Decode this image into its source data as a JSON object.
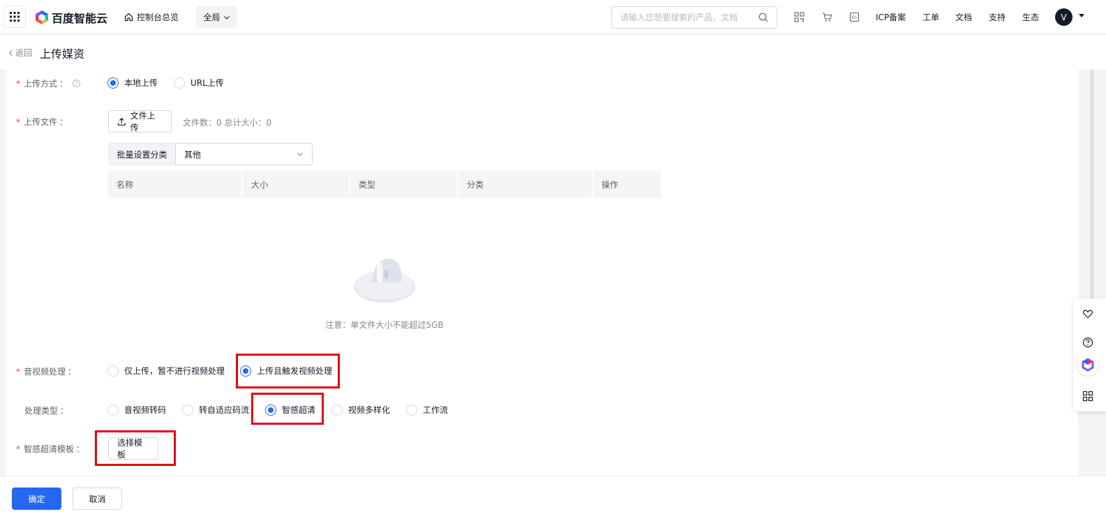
{
  "topbar": {
    "brand": "百度智能云",
    "home_link": "控制台总览",
    "region": "全局",
    "search_placeholder": "请输入您想要搜索的产品、文档",
    "links": [
      "ICP备案",
      "工单",
      "文档",
      "支持",
      "生态"
    ],
    "avatar_initial": "V",
    "icons": [
      "apps-grid-icon",
      "qrcode-icon",
      "cart-icon",
      "language-icon",
      "search-icon"
    ]
  },
  "page": {
    "back_label": "返回",
    "title": "上传媒资"
  },
  "form": {
    "upload_method": {
      "label": "上传方式",
      "options": [
        "本地上传",
        "URL上传"
      ],
      "selected": "本地上传"
    },
    "upload_file": {
      "label": "上传文件",
      "button": "文件上传",
      "stats": "文件数：0   总计大小：0"
    },
    "batch_category": {
      "label": "批量设置分类",
      "value": "其他"
    },
    "table": {
      "columns": [
        "名称",
        "大小",
        "类型",
        "分类",
        "操作"
      ],
      "empty_note": "注意：单文件大小不能超过5GB"
    },
    "av_processing": {
      "label": "音视频处理",
      "options": [
        "仅上传，暂不进行视频处理",
        "上传且触发视频处理"
      ],
      "selected": "上传且触发视频处理"
    },
    "process_type": {
      "label": "处理类型",
      "options": [
        "音视频转码",
        "转自适应码流",
        "智感超清",
        "视频多样化",
        "工作流"
      ],
      "selected": "智感超清"
    },
    "template": {
      "label": "智感超清模板",
      "button": "选择模板"
    }
  },
  "footer": {
    "confirm": "确定",
    "cancel": "取消"
  },
  "colors": {
    "primary": "#2468f2",
    "highlight": "#e60012",
    "required": "#f33e3e"
  }
}
